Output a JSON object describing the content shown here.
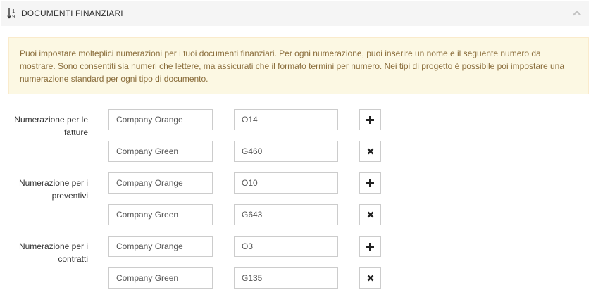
{
  "header": {
    "title": "DOCUMENTI FINANZIARI",
    "icon": "sort-numeric-icon",
    "collapse_icon": "chevron-up-icon"
  },
  "info": {
    "text": "Puoi impostare molteplici numerazioni per i tuoi documenti finanziari. Per ogni numerazione, puoi inserire un nome e il seguente numero da mostrare. Sono consentiti sia numeri che lettere, ma assicurati che il formato termini per numero. Nei tipi di progetto è possibile poi impostare una numerazione standard per ogni tipo di documento."
  },
  "groups": [
    {
      "label": "Numerazione per le fatture",
      "rows": [
        {
          "name": "Company Orange",
          "number": "O14",
          "action": "add"
        },
        {
          "name": "Company Green",
          "number": "G460",
          "action": "remove"
        }
      ]
    },
    {
      "label": "Numerazione per i preventivi",
      "rows": [
        {
          "name": "Company Orange",
          "number": "O10",
          "action": "add"
        },
        {
          "name": "Company Green",
          "number": "G643",
          "action": "remove"
        }
      ]
    },
    {
      "label": "Numerazione per i contratti",
      "rows": [
        {
          "name": "Company Orange",
          "number": "O3",
          "action": "add"
        },
        {
          "name": "Company Green",
          "number": "G135",
          "action": "remove"
        }
      ]
    }
  ],
  "colors": {
    "header_bg": "#f5f5f5",
    "info_bg": "#fcf8e3",
    "info_border": "#faebcc",
    "info_text": "#8a6d3b",
    "input_border": "#cccccc"
  }
}
